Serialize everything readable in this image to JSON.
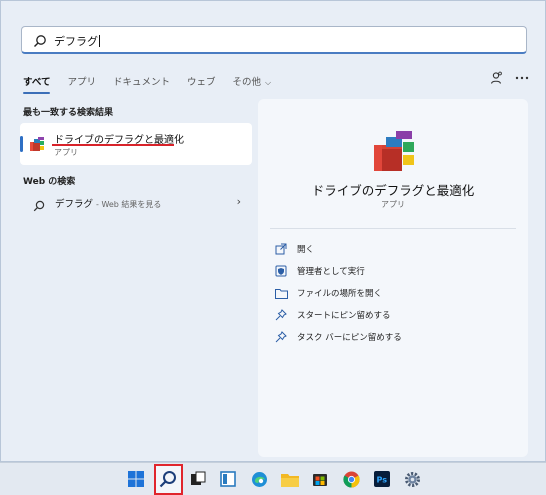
{
  "search": {
    "query": "デフラグ"
  },
  "tabs": [
    {
      "label": "すべて"
    },
    {
      "label": "アプリ"
    },
    {
      "label": "ドキュメント"
    },
    {
      "label": "ウェブ"
    },
    {
      "label": "その他"
    }
  ],
  "best_match": {
    "heading": "最も一致する検索結果",
    "title": "ドライブのデフラグと最適化",
    "subtitle": "アプリ"
  },
  "web": {
    "heading": "Web の検索",
    "query": "デフラグ",
    "suffix": "- Web 結果を見る"
  },
  "preview": {
    "name": "ドライブのデフラグと最適化",
    "type": "アプリ",
    "actions": [
      {
        "label": "開く",
        "icon": "open-icon"
      },
      {
        "label": "管理者として実行",
        "icon": "admin-shield-icon"
      },
      {
        "label": "ファイルの場所を開く",
        "icon": "folder-icon"
      },
      {
        "label": "スタートにピン留めする",
        "icon": "pin-icon"
      },
      {
        "label": "タスク バーにピン留めする",
        "icon": "pin-icon"
      }
    ]
  },
  "colors": {
    "accent": "#2e6fc4",
    "highlight_red": "#e0252c"
  }
}
